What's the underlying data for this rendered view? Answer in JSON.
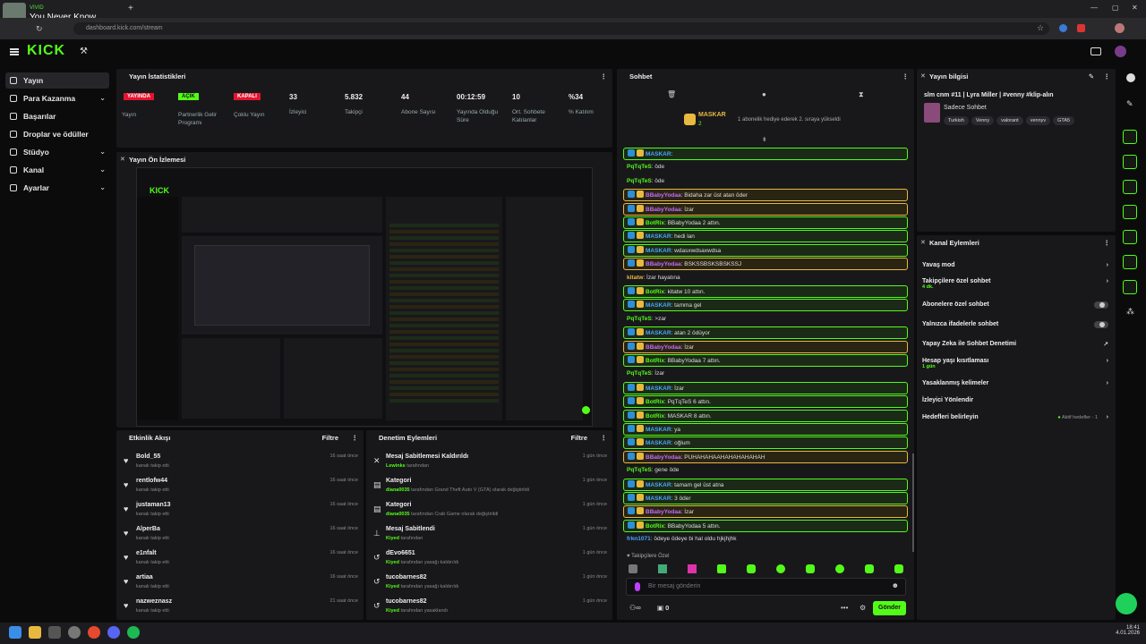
{
  "browser": {
    "tab_sub": "VIVID",
    "tab_title": "You Never Know",
    "url": "dashboard.kick.com/stream",
    "new_tab": "+"
  },
  "app": {
    "logo": "KICK"
  },
  "sidebar": {
    "items": [
      {
        "label": "Yayın",
        "icon": "broadcast-icon",
        "chev": ""
      },
      {
        "label": "Para Kazanma",
        "icon": "dollar-icon",
        "chev": "⌄"
      },
      {
        "label": "Başarılar",
        "icon": "trophy-icon",
        "chev": ""
      },
      {
        "label": "Droplar ve ödüller",
        "icon": "gift-icon",
        "chev": ""
      },
      {
        "label": "Stüdyo",
        "icon": "studio-icon",
        "chev": "⌄"
      },
      {
        "label": "Kanal",
        "icon": "channel-icon",
        "chev": "⌄"
      },
      {
        "label": "Ayarlar",
        "icon": "gear-icon",
        "chev": "⌄"
      }
    ]
  },
  "stats": {
    "title": "Yayın İstatistikleri",
    "items": [
      {
        "pill": "YAYINDA",
        "pill_color": "#e5142e",
        "label": "Yayın"
      },
      {
        "pill": "AÇIK",
        "pill_color": "#53fc18",
        "label": "Partnerlik Gelir Programı"
      },
      {
        "pill": "KAPALI",
        "pill_color": "#e5142e",
        "label": "Çoklu Yayın"
      },
      {
        "value": "33",
        "label": "İzleyici"
      },
      {
        "value": "5.832",
        "label": "Takipçi"
      },
      {
        "value": "44",
        "label": "Abone Sayısı"
      },
      {
        "value": "00:12:59",
        "label": "Yayında Olduğu Süre"
      },
      {
        "value": "10",
        "label": "Ort. Sohbete Katılanlar"
      },
      {
        "value": "%34",
        "label": "% Katılım"
      }
    ]
  },
  "preview": {
    "title": "Yayın Ön İzlemesi"
  },
  "activity": {
    "title": "Etkinlik Akışı",
    "filter": "Filtre",
    "items": [
      {
        "name": "Bold_55",
        "desc": "kanalı takip etti",
        "time": "16 saat önce"
      },
      {
        "name": "rentlofw44",
        "desc": "kanalı takip etti",
        "time": "16 saat önce"
      },
      {
        "name": "justaman13",
        "desc": "kanalı takip etti",
        "time": "16 saat önce"
      },
      {
        "name": "AlperBa",
        "desc": "kanalı takip etti",
        "time": "16 saat önce"
      },
      {
        "name": "e1nfalt",
        "desc": "kanalı takip etti",
        "time": "16 saat önce"
      },
      {
        "name": "artiaa",
        "desc": "kanalı takip etti",
        "time": "16 saat önce"
      },
      {
        "name": "nazweznasz",
        "desc": "kanalı takip etti",
        "time": "21 saat önce"
      }
    ]
  },
  "moderation": {
    "title": "Denetim Eylemleri",
    "filter": "Filtre",
    "items": [
      {
        "title": "Mesaj Sabitlemesi Kaldırıldı",
        "user": "Lewinks",
        "desc": "tarafından",
        "time": "1 gün önce",
        "icon": "unpin-icon"
      },
      {
        "title": "Kategori",
        "user": "diana0035",
        "desc": "tarafından Grand Theft Auto V (GTA) olarak değiştirildi",
        "time": "1 gün önce",
        "icon": "category-icon"
      },
      {
        "title": "Kategori",
        "user": "diana0035",
        "desc": "tarafından Crab Game olarak değiştirildi",
        "time": "1 gün önce",
        "icon": "category-icon"
      },
      {
        "title": "Mesaj Sabitlendi",
        "user": "Kiyed",
        "desc": "tarafından",
        "time": "1 gün önce",
        "icon": "pin-icon"
      },
      {
        "title": "dEvo6651",
        "user": "Kiyed",
        "desc": "tarafından yasağı kaldırıldı",
        "time": "1 gün önce",
        "icon": "unban-icon"
      },
      {
        "title": "tucobarnes82",
        "user": "Kiyed",
        "desc": "tarafından yasağı kaldırıldı",
        "time": "1 gün önce",
        "icon": "unban-icon"
      },
      {
        "title": "tucobarnes82",
        "user": "Kiyed",
        "desc": "tarafından yasaklandı",
        "time": "1 gün önce",
        "icon": "ban-icon"
      }
    ]
  },
  "chat": {
    "title": "Sohbet",
    "top_user": "MASKAR",
    "top_count": "2",
    "top_note": "1 abonelik hediye ederek 2. sıraya yükseldi",
    "messages": [
      {
        "user": "MASKAR",
        "text": ":",
        "type": "mod",
        "ucolor": "#4aa3ff"
      },
      {
        "user": "PqTqTeS",
        "text": ": öde",
        "type": "",
        "ucolor": "#53fc18"
      },
      {
        "user": "PqTqTeS",
        "text": ": öde",
        "type": "",
        "ucolor": "#53fc18"
      },
      {
        "user": "BBabyYodaa",
        "text": ": Bidaha zar üst atan öder",
        "type": "sub",
        "ucolor": "#c46bff"
      },
      {
        "user": "BBabyYodaa",
        "text": ": İzar",
        "type": "sub",
        "ucolor": "#c46bff"
      },
      {
        "user": "BotRix",
        "text": ": BBabyYodaa 2 attın.",
        "type": "mod",
        "ucolor": "#53fc18"
      },
      {
        "user": "MASKAR",
        "text": ": hedi lan",
        "type": "mod",
        "ucolor": "#4aa3ff"
      },
      {
        "user": "MASKAR",
        "text": ": wdasxwdsaxwdsa",
        "type": "mod",
        "ucolor": "#4aa3ff"
      },
      {
        "user": "BBabyYodaa",
        "text": ":  BSKSSBSKSBSKSSJ",
        "type": "sub",
        "ucolor": "#c46bff"
      },
      {
        "user": "kitatw",
        "text": ": İzar hayatına",
        "type": "",
        "ucolor": "#e8b93e"
      },
      {
        "user": "BotRix",
        "text": ": kitatw 10 attın.",
        "type": "mod",
        "ucolor": "#53fc18"
      },
      {
        "user": "MASKAR",
        "text": ": tamma gel",
        "type": "mod",
        "ucolor": "#4aa3ff"
      },
      {
        "user": "PqTqTeS",
        "text": ": >zar",
        "type": "",
        "ucolor": "#53fc18"
      },
      {
        "user": "MASKAR",
        "text": ": atan 2 ödüyor",
        "type": "mod",
        "ucolor": "#4aa3ff"
      },
      {
        "user": "BBabyYodaa",
        "text": ": İzar",
        "type": "sub",
        "ucolor": "#c46bff"
      },
      {
        "user": "BotRix",
        "text": ": BBabyYodaa 7 attın.",
        "type": "mod",
        "ucolor": "#53fc18"
      },
      {
        "user": "PqTqTeS",
        "text": ": İzar",
        "type": "",
        "ucolor": "#53fc18"
      },
      {
        "user": "MASKAR",
        "text": ": İzar",
        "type": "mod",
        "ucolor": "#4aa3ff"
      },
      {
        "user": "BotRix",
        "text": ": PqTqTeS 6 attın.",
        "type": "mod",
        "ucolor": "#53fc18"
      },
      {
        "user": "BotRix",
        "text": ": MASKAR 8 attın.",
        "type": "mod",
        "ucolor": "#53fc18"
      },
      {
        "user": "MASKAR",
        "text": ": ya",
        "type": "mod",
        "ucolor": "#4aa3ff"
      },
      {
        "user": "MASKAR",
        "text": ": oğlum",
        "type": "mod",
        "ucolor": "#4aa3ff"
      },
      {
        "user": "BBabyYodaa",
        "text": ": PUHAHAHAAHAHAHAHAHAH",
        "type": "sub",
        "ucolor": "#c46bff"
      },
      {
        "user": "PqTqTeS",
        "text": ": gene öde",
        "type": "",
        "ucolor": "#53fc18"
      },
      {
        "user": "MASKAR",
        "text": ": tamam gel üst atna",
        "type": "mod",
        "ucolor": "#4aa3ff"
      },
      {
        "user": "MASKAR",
        "text": ": 3 öder",
        "type": "mod",
        "ucolor": "#4aa3ff"
      },
      {
        "user": "BBabyYodaa",
        "text": ": İzar",
        "type": "sub",
        "ucolor": "#c46bff"
      },
      {
        "user": "BotRix",
        "text": ": BBabyYodaa 5 attın.",
        "type": "mod",
        "ucolor": "#53fc18"
      },
      {
        "user": "frkn1071",
        "text": ": ödeye ödeye bi hal oldu hjkjhjhk",
        "type": "",
        "ucolor": "#4aa3ff"
      }
    ],
    "followers_label": "Takipçilere Özel",
    "input_placeholder": "Bir mesaj gönderin",
    "count": "0",
    "send": "Gönder"
  },
  "stream_info": {
    "title": "Yayın bilgisi",
    "stream_title": "slm cnm #11 | Lyra Miller | #venny #klip-alın",
    "chat_mode": "Sadece Sohbet",
    "tags": [
      "Turkish",
      "Venny",
      "valorant",
      "vennyv",
      "GTA5"
    ]
  },
  "channel_actions": {
    "title": "Kanal Eylemleri",
    "items": [
      {
        "label": "Yavaş mod",
        "sub": "",
        "ctrl": "arrow"
      },
      {
        "label": "Takipçilere özel sohbet",
        "sub": "4 dk.",
        "ctrl": "arrow"
      },
      {
        "label": "Abonelere özel sohbet",
        "sub": "",
        "ctrl": "toggle"
      },
      {
        "label": "Yalnızca ifadelerle sohbet",
        "sub": "",
        "ctrl": "toggle"
      },
      {
        "label": "Yapay Zeka ile Sohbet Denetimi",
        "sub": "",
        "ctrl": "ext"
      },
      {
        "label": "Hesap yaşı kısıtlaması",
        "sub": "1 gün",
        "ctrl": "arrow"
      },
      {
        "label": "Yasaklanmış kelimeler",
        "sub": "",
        "ctrl": "arrow"
      },
      {
        "label": "İzleyici Yönlendir",
        "sub": "",
        "ctrl": ""
      },
      {
        "label": "Hedefleri belirleyin",
        "sub": "",
        "ctrl": "arrow",
        "note": "Aktif hedefler - 1"
      }
    ]
  },
  "taskbar": {
    "time": "18:41",
    "date": "4.01.2026"
  }
}
